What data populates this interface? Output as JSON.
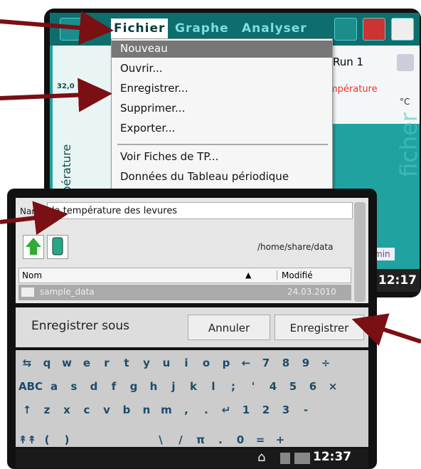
{
  "top_window": {
    "menus": [
      "Fichier",
      "Graphe",
      "Analyser"
    ],
    "y_tick": "32,0",
    "y_axis_label": "Température (°",
    "run_label": "Run 1",
    "sensor_label": "mpérature",
    "sensor_unit": "°C",
    "background_text": "ficher",
    "min_label": "min",
    "clock": "12:17"
  },
  "dropdown": {
    "items": [
      "Nouveau",
      "Ouvrir...",
      "Enregistrer...",
      "Supprimer...",
      "Exporter...",
      "Voir Fiches de TP...",
      "Données du Tableau périodique"
    ],
    "highlighted": "Nouveau"
  },
  "save_dialog": {
    "name_label": "Nam",
    "name_value": "la température des levures",
    "path": "/home/share/data",
    "columns": [
      "Nom",
      "Modifié"
    ],
    "rows": [
      {
        "name": "sample_data",
        "date": "24.03.2010"
      }
    ],
    "title": "Enregistrer sous",
    "cancel": "Annuler",
    "save": "Enregistrer"
  },
  "keyboard": {
    "row1": [
      "⇆",
      "q",
      "w",
      "e",
      "r",
      "t",
      "y",
      "u",
      "i",
      "o",
      "p",
      "←",
      "7",
      "8",
      "9",
      "÷"
    ],
    "row2": [
      "ABC",
      "a",
      "s",
      "d",
      "f",
      "g",
      "h",
      "j",
      "k",
      "l",
      ";",
      "'",
      "4",
      "5",
      "6",
      "×"
    ],
    "row3": [
      "↑",
      "z",
      "x",
      "c",
      "v",
      "b",
      "n",
      "m",
      ",",
      ".",
      "↵",
      "1",
      "2",
      "3",
      "-"
    ],
    "row4": [
      "↟↟",
      "(",
      ")",
      "",
      "\\",
      "/",
      "π",
      ".",
      "0",
      "=",
      "+"
    ]
  },
  "status_bar": {
    "clock": "12:37"
  },
  "colors": {
    "teal": "#20a3a0",
    "arrow": "#7a0f14"
  }
}
